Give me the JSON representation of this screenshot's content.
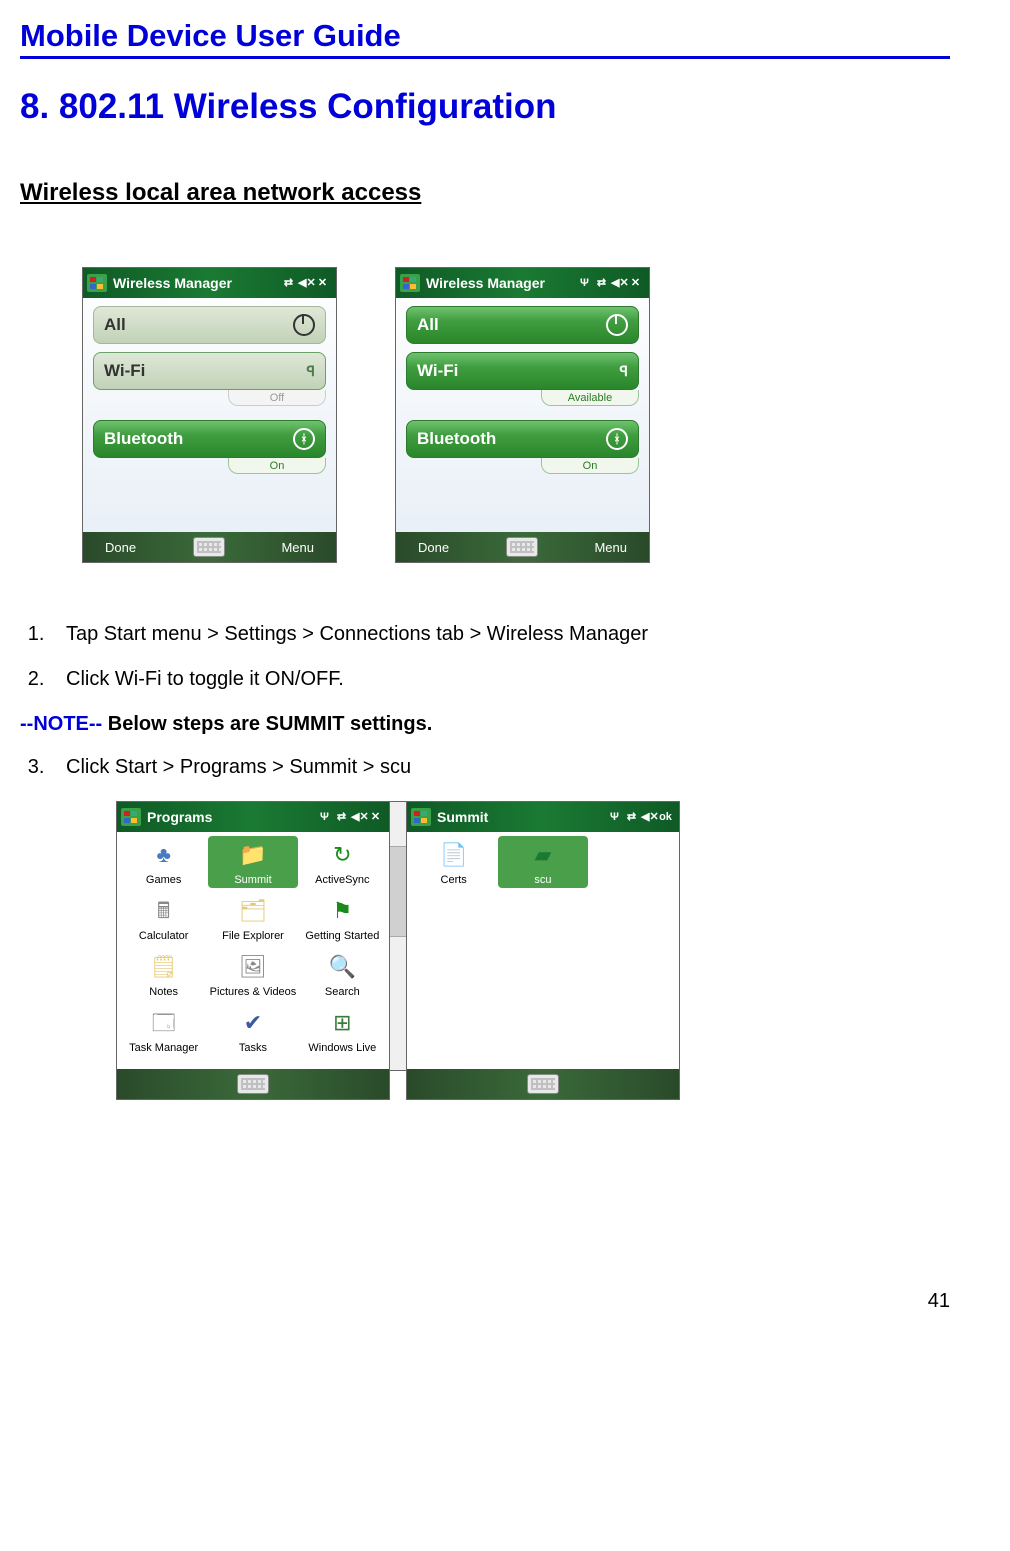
{
  "header": "Mobile Device User Guide",
  "section_title": "8.  802.11 Wireless Configuration",
  "subheading": "Wireless local area network access",
  "steps_a": {
    "item1": "Tap Start menu > Settings > Connections tab > Wireless Manager",
    "item2": "Click Wi-Fi to toggle it ON/OFF."
  },
  "note": {
    "tag": "--NOTE--",
    "text": " Below steps are SUMMIT settings."
  },
  "steps_b": {
    "item3": "Click Start > Programs > Summit > scu"
  },
  "page_number": "41",
  "wm_left": {
    "title": "Wireless Manager",
    "all": "All",
    "wifi": "Wi-Fi",
    "wifi_state": "Off",
    "bt": "Bluetooth",
    "bt_state": "On",
    "done": "Done",
    "menu": "Menu"
  },
  "wm_right": {
    "title": "Wireless Manager",
    "all": "All",
    "wifi": "Wi-Fi",
    "wifi_state": "Available",
    "bt": "Bluetooth",
    "bt_state": "On",
    "done": "Done",
    "menu": "Menu"
  },
  "programs": {
    "title": "Programs",
    "apps": {
      "games": "Games",
      "summit": "Summit",
      "activesync": "ActiveSync",
      "calculator": "Calculator",
      "fileexplorer": "File Explorer",
      "getting": "Getting Started",
      "notes": "Notes",
      "pictures": "Pictures & Videos",
      "search": "Search",
      "taskmgr": "Task Manager",
      "tasks": "Tasks",
      "live": "Windows Live"
    }
  },
  "summit": {
    "title": "Summit",
    "ok": "ok",
    "apps": {
      "certs": "Certs",
      "scu": "scu"
    }
  }
}
